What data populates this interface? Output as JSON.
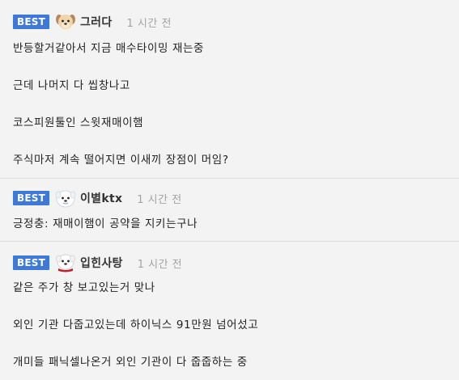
{
  "comments": [
    {
      "badge": "BEST",
      "avatar": "puppy-icon",
      "nickname": "그러다",
      "time": "1 시간 전",
      "lines": [
        "반등할거같아서 지금 매수타이밍 재는중",
        "근데 나머지 다 씹창나고",
        "코스피원툴인 스윗재매이햄",
        "주식마저 계속 떨어지면 이새끼 장점이 머임?"
      ]
    },
    {
      "badge": "BEST",
      "avatar": "white-dog-icon",
      "nickname": "이별ktx",
      "time": "1 시간 전",
      "lines": [
        "긍정충: 재매이햄이 공약을 지키는구나"
      ]
    },
    {
      "badge": "BEST",
      "avatar": "white-dog-scarf-icon",
      "nickname": "입힌사탕",
      "time": "1 시간 전",
      "lines": [
        "같은 주가 창 보고있는거 맞나",
        "외인 기관 다줍고있는데 하이닉스 91만원 넘어섰고",
        "개미들 패닉셀나온거 외인 기관이 다 줍줍하는 중"
      ]
    }
  ],
  "colors": {
    "badge": "#3f79d8",
    "background": "#f3f3f3",
    "time": "#a3a3a3",
    "divider": "#dcdcdc"
  }
}
